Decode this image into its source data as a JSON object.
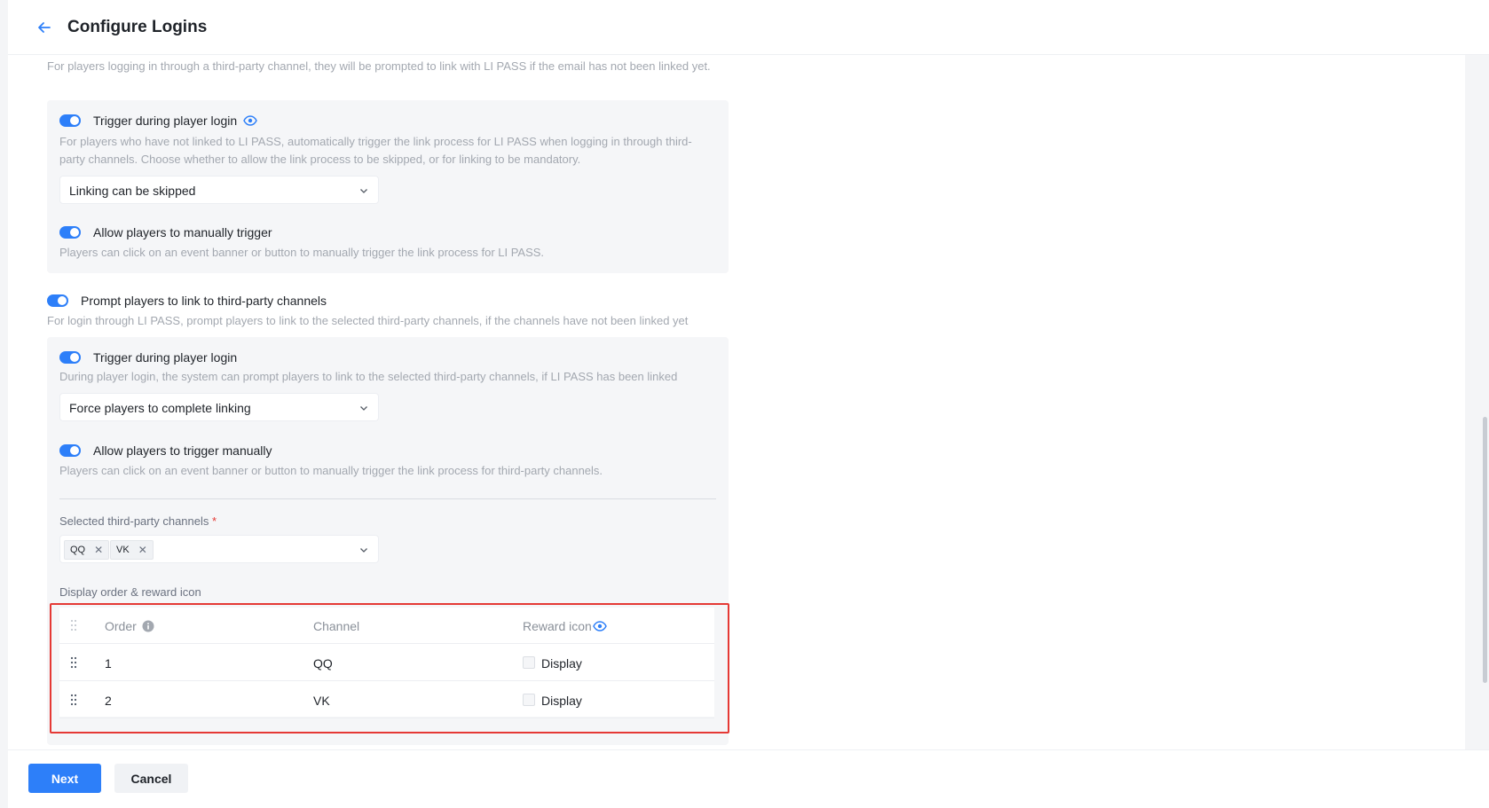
{
  "header": {
    "title": "Configure Logins"
  },
  "intro_desc": "For players logging in through a third-party channel, they will be prompted to link with LI PASS if the email has not been linked yet.",
  "panel1": {
    "trigger_login": {
      "label": "Trigger during player login",
      "desc": "For players who have not linked to LI PASS, automatically trigger the link process for LI PASS when logging in through third-party channels. Choose whether to allow the link process to be skipped, or for linking to be mandatory.",
      "select_value": "Linking can be skipped"
    },
    "manual_trigger": {
      "label": "Allow players to manually trigger",
      "desc": "Players can click on an event banner or button to manually trigger the link process for LI PASS."
    }
  },
  "prompt_third_party": {
    "label": "Prompt players to link to third-party channels",
    "desc": "For login through LI PASS, prompt players to link to the selected third-party channels, if the channels have not been linked yet"
  },
  "panel2": {
    "trigger_login": {
      "label": "Trigger during player login",
      "desc": "During player login, the system can prompt players to link to the selected third-party channels, if LI PASS has been linked",
      "select_value": "Force players to complete linking"
    },
    "manual_trigger": {
      "label": "Allow players to trigger manually",
      "desc": "Players can click on an event banner or button to manually trigger the link process for third-party channels."
    },
    "channels": {
      "label": "Selected third-party channels",
      "required_mark": "*",
      "tags": [
        "QQ",
        "VK"
      ],
      "remove_glyph": "✕"
    },
    "order_table": {
      "label": "Display order & reward icon",
      "headers": {
        "order": "Order",
        "channel": "Channel",
        "reward": "Reward icon"
      },
      "rows": [
        {
          "order": "1",
          "channel": "QQ",
          "reward_label": "Display",
          "checked": false
        },
        {
          "order": "2",
          "channel": "VK",
          "reward_label": "Display",
          "checked": false
        }
      ]
    }
  },
  "footer": {
    "next": "Next",
    "cancel": "Cancel"
  },
  "colors": {
    "accent": "#2d7ff9",
    "highlight": "#e53935"
  }
}
